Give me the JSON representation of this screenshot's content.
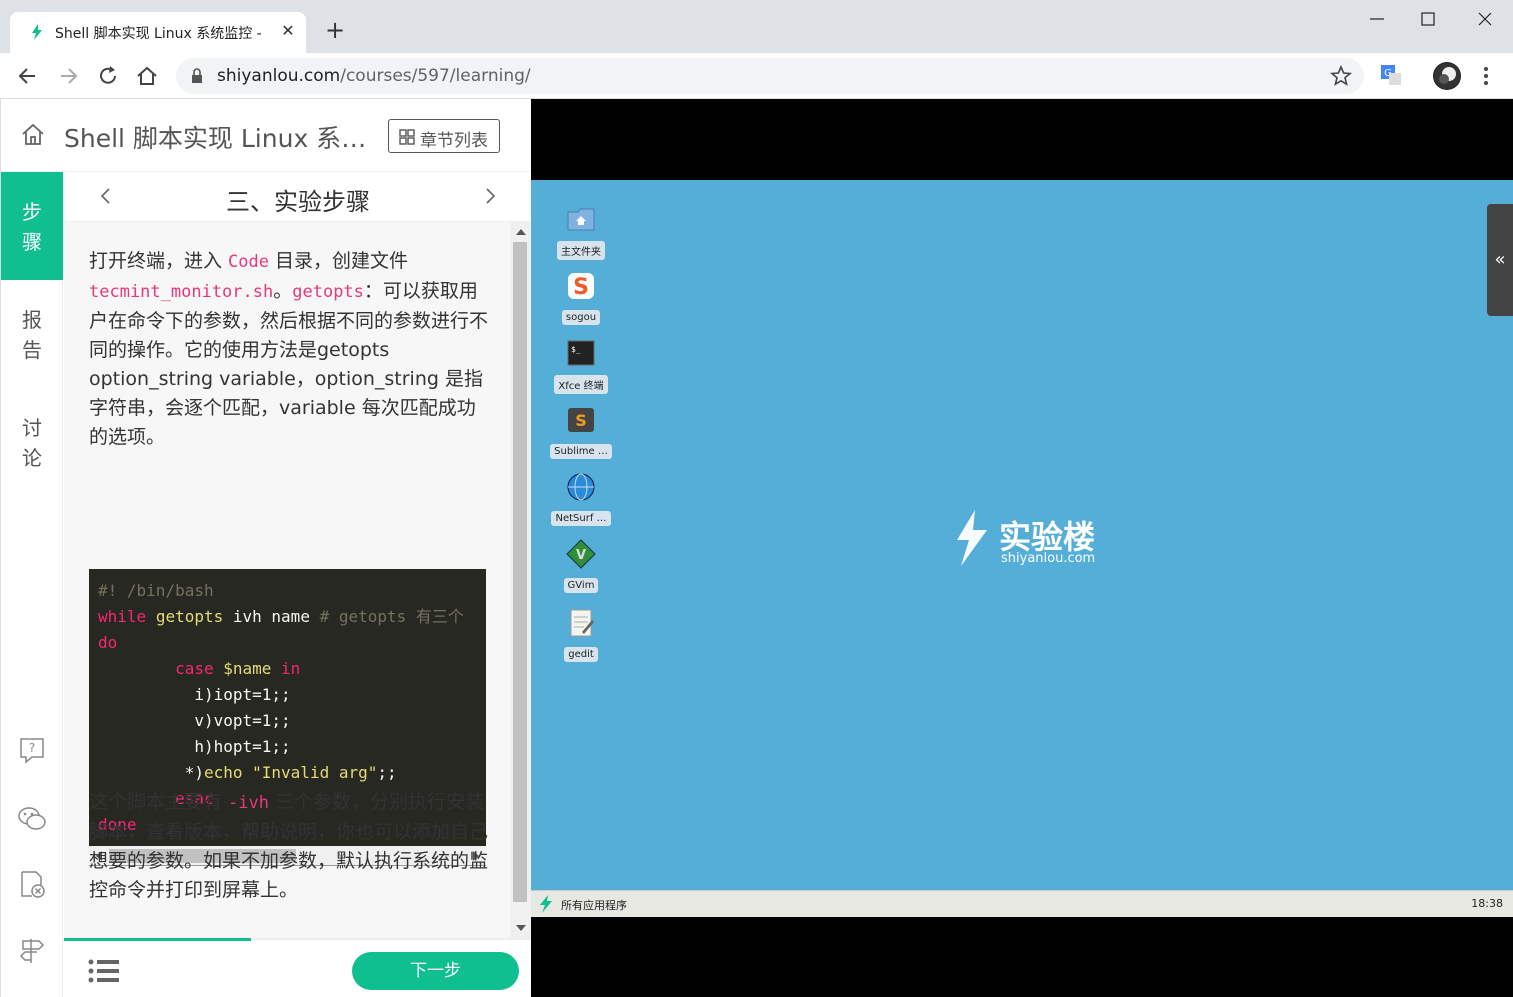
{
  "browser": {
    "tab_title": "Shell 脚本实现 Linux 系统监控 - ",
    "tab_close": "✕",
    "new_tab": "+",
    "url_host": "shiyanlou.com",
    "url_path": "/courses/597/learning/",
    "accent": "#0fbf8f"
  },
  "header": {
    "course_title": "Shell 脚本实现 Linux 系统监控",
    "chapter_button": "章节列表"
  },
  "side_nav": {
    "items": [
      {
        "label": "步骤",
        "active": true
      },
      {
        "label": "报告",
        "active": false
      },
      {
        "label": "讨论",
        "active": false
      }
    ],
    "tools": [
      "question-icon",
      "wechat-icon",
      "file-close-icon",
      "signpost-icon"
    ]
  },
  "step": {
    "title": "三、实验步骤",
    "para1_a": "打开终端，进入 ",
    "para1_code1": "Code",
    "para1_b": " 目录，创建文件 ",
    "para1_code2": "tecmint_monitor.sh",
    "para1_c": "。",
    "para1_code3": "getopts",
    "para1_d": "：可以获取用户在命令下的参数，然后根据不同的参数进行不同的操作。它的使用方法是getopts option_string variable，option_string 是指字符串，会逐个匹配，variable 每次匹配成功的选项。",
    "para2_a": "这个脚本主要有 ",
    "para2_code": "-ivh",
    "para2_b": " 三个参数，分别执行安装脚本，查看版本，帮助说明，你也可以添加自己想要的参数。如果不加参数，默认执行系统的监控命令并打印到屏幕上。",
    "next_button": "下一步",
    "progress_fraction": 0.4
  },
  "code": {
    "l1": "#! /bin/bash",
    "l2_kw": "while",
    "l2_fn": "getopts",
    "l2_rest": " ivh name ",
    "l2_cmt": "# getopts 有三个",
    "l3": "do",
    "l4_kw": "case",
    "l4_var": "$name",
    "l4_kw2": "in",
    "l5": "i)iopt=1;;",
    "l6": "v)vopt=1;;",
    "l7": "h)hopt=1;;",
    "l8_a": "*)",
    "l8_fn": "echo",
    "l8_str": "\"Invalid arg\"",
    "l8_b": ";;",
    "l9": "esac",
    "l10": "done"
  },
  "desktop": {
    "icons": [
      {
        "name": "home-folder",
        "label": "主文件夹"
      },
      {
        "name": "sogou",
        "label": "sogou"
      },
      {
        "name": "xfce-terminal",
        "label": "Xfce 终端"
      },
      {
        "name": "sublime",
        "label": "Sublime …"
      },
      {
        "name": "netsurf",
        "label": "NetSurf …"
      },
      {
        "name": "gvim",
        "label": "GVim"
      },
      {
        "name": "gedit",
        "label": "gedit"
      }
    ],
    "brand_name": "实验楼",
    "brand_url": "shiyanlou.com",
    "collapse": "«",
    "taskbar_apps": "所有应用程序",
    "clock": "18:38",
    "bg_color": "#55aed8"
  }
}
